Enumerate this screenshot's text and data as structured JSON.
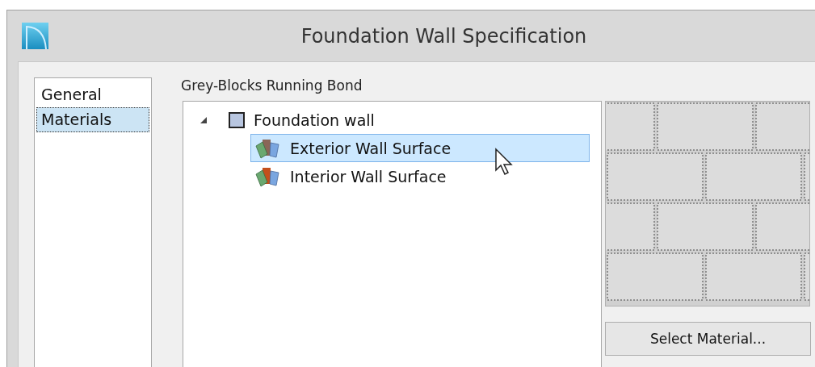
{
  "window": {
    "title": "Foundation Wall Specification"
  },
  "sidebar": {
    "items": [
      {
        "label": "General",
        "selected": false
      },
      {
        "label": "Materials",
        "selected": true
      }
    ]
  },
  "material_name": "Grey-Blocks Running Bond",
  "tree": [
    {
      "label": "Foundation wall",
      "expanded": true,
      "children": [
        {
          "label": "Exterior Wall Surface",
          "selected": true,
          "color": "#8a6657"
        },
        {
          "label": "Interior Wall Surface",
          "selected": false,
          "color": "#c4501c"
        }
      ]
    }
  ],
  "select_button": "Select Material..."
}
